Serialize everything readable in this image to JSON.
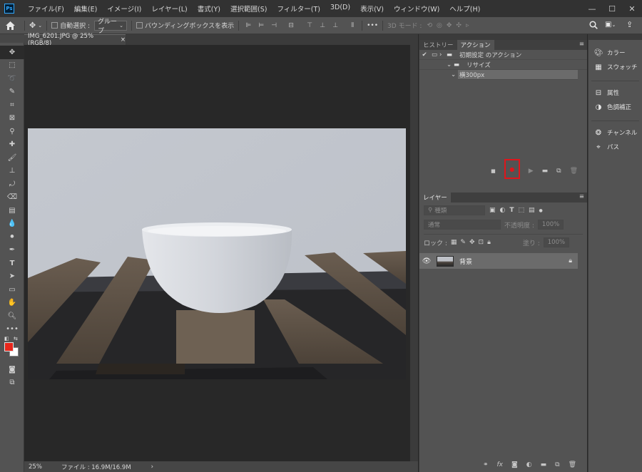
{
  "app": {
    "logo": "Ps"
  },
  "menu": [
    "ファイル(F)",
    "編集(E)",
    "イメージ(I)",
    "レイヤー(L)",
    "書式(Y)",
    "選択範囲(S)",
    "フィルター(T)",
    "3D(D)",
    "表示(V)",
    "ウィンドウ(W)",
    "ヘルプ(H)"
  ],
  "window_controls": {
    "minimize": "—",
    "maximize": "☐",
    "close": "✕"
  },
  "options": {
    "auto_select_label": "自動選択 :",
    "auto_select_value": "グループ",
    "bbox_label": "バウンディングボックスを表示",
    "mode_3d_label": "3D モード :",
    "more": "•••"
  },
  "document": {
    "tab_title": "IMG_6201.JPG @ 25% (RGB/8)",
    "tab_close": "×",
    "zoom": "25%",
    "file_info": "ファイル : 16.9M/16.9M",
    "status_arrow": "›"
  },
  "actions_panel": {
    "tabs": [
      "ヒストリー",
      "アクション"
    ],
    "active_tab": 1,
    "rows": [
      {
        "label": "初期設定 のアクション",
        "check": "✔",
        "indent": 0,
        "twisty": "›"
      },
      {
        "label": "リサイズ",
        "check": "",
        "indent": 1,
        "twisty": "⌄"
      },
      {
        "label": "横300px",
        "check": "",
        "indent": 2,
        "twisty": "⌄"
      }
    ],
    "record_highlight_color": "#e0151b"
  },
  "layers_panel": {
    "tab": "レイヤー",
    "kind_label": "種類",
    "blend_mode": "通常",
    "opacity_label": "不透明度 :",
    "opacity_value": "100%",
    "lock_label": "ロック :",
    "fill_label": "塗り :",
    "fill_value": "100%",
    "layers": [
      {
        "name": "背景",
        "visible": true,
        "locked": true
      }
    ]
  },
  "dock": [
    {
      "label": "カラー",
      "icon": "palette-icon"
    },
    {
      "label": "スウォッチ",
      "icon": "swatches-icon"
    },
    {
      "label": "属性",
      "icon": "properties-icon"
    },
    {
      "label": "色調補正",
      "icon": "adjustments-icon"
    },
    {
      "label": "チャンネル",
      "icon": "channels-icon"
    },
    {
      "label": "パス",
      "icon": "paths-icon"
    }
  ],
  "colors": {
    "foreground": "#e8261b",
    "background": "#ffffff",
    "accent": "#31a8ff"
  }
}
